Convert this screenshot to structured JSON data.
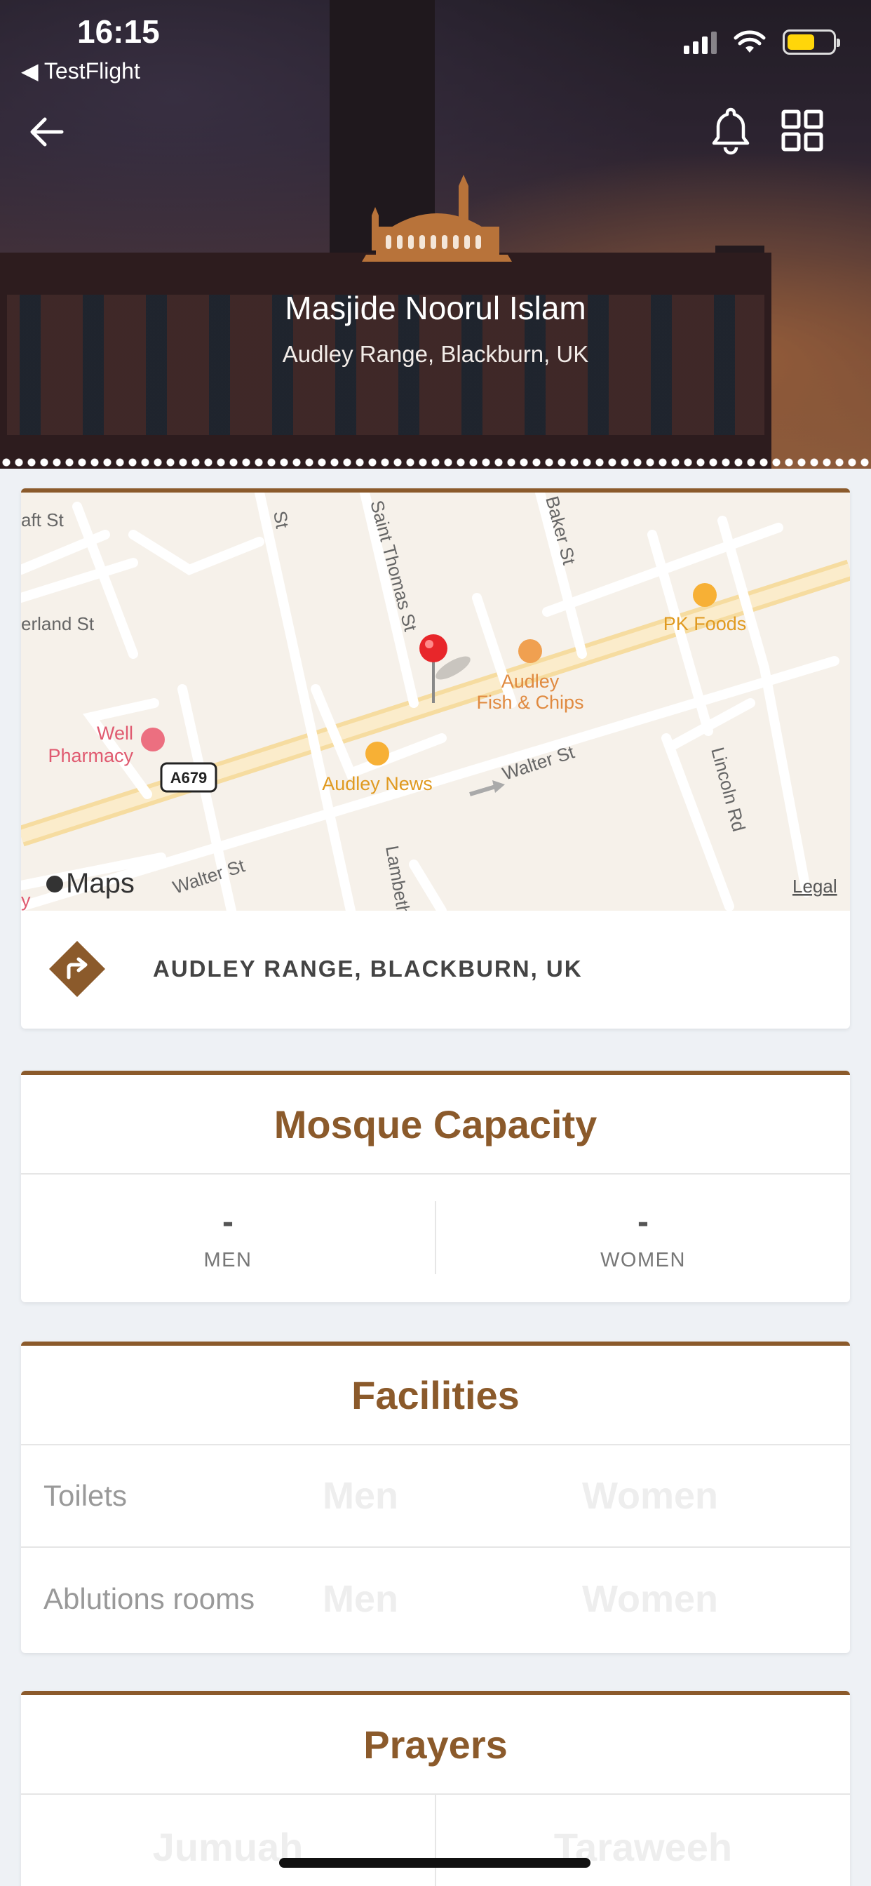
{
  "status_bar": {
    "time": "16:15",
    "back_app": "◀ TestFlight"
  },
  "header": {
    "title": "Masjide Noorul Islam",
    "subtitle": "Audley Range, Blackburn, UK"
  },
  "map": {
    "attribution": "Maps",
    "legal": "Legal",
    "streets": [
      "aft St",
      "erland St",
      "St",
      "Saint Thomas St",
      "Baker St",
      "Walter St",
      "Walter St",
      "Lambeth",
      "Lincoln Rd"
    ],
    "road_shield": "A679",
    "pois": [
      {
        "line1": "Audley",
        "line2": "Fish & Chips"
      },
      {
        "line1": "PK Foods"
      },
      {
        "line1": "Audley News"
      },
      {
        "line1": "Well",
        "line2": "Pharmacy"
      }
    ],
    "edge_text": "y"
  },
  "address": {
    "label": "AUDLEY RANGE, BLACKBURN, UK"
  },
  "capacity": {
    "title": "Mosque Capacity",
    "men_value": "-",
    "men_label": "MEN",
    "women_value": "-",
    "women_label": "WOMEN"
  },
  "facilities": {
    "title": "Facilities",
    "rows": [
      {
        "name": "Toilets",
        "men": "Men",
        "women": "Women"
      },
      {
        "name": "Ablutions rooms",
        "men": "Men",
        "women": "Women"
      }
    ]
  },
  "prayers": {
    "title": "Prayers",
    "col1": "Jumuah",
    "col2": "Taraweeh"
  },
  "colors": {
    "accent": "#8b5a2b",
    "background": "#eef1f5"
  }
}
